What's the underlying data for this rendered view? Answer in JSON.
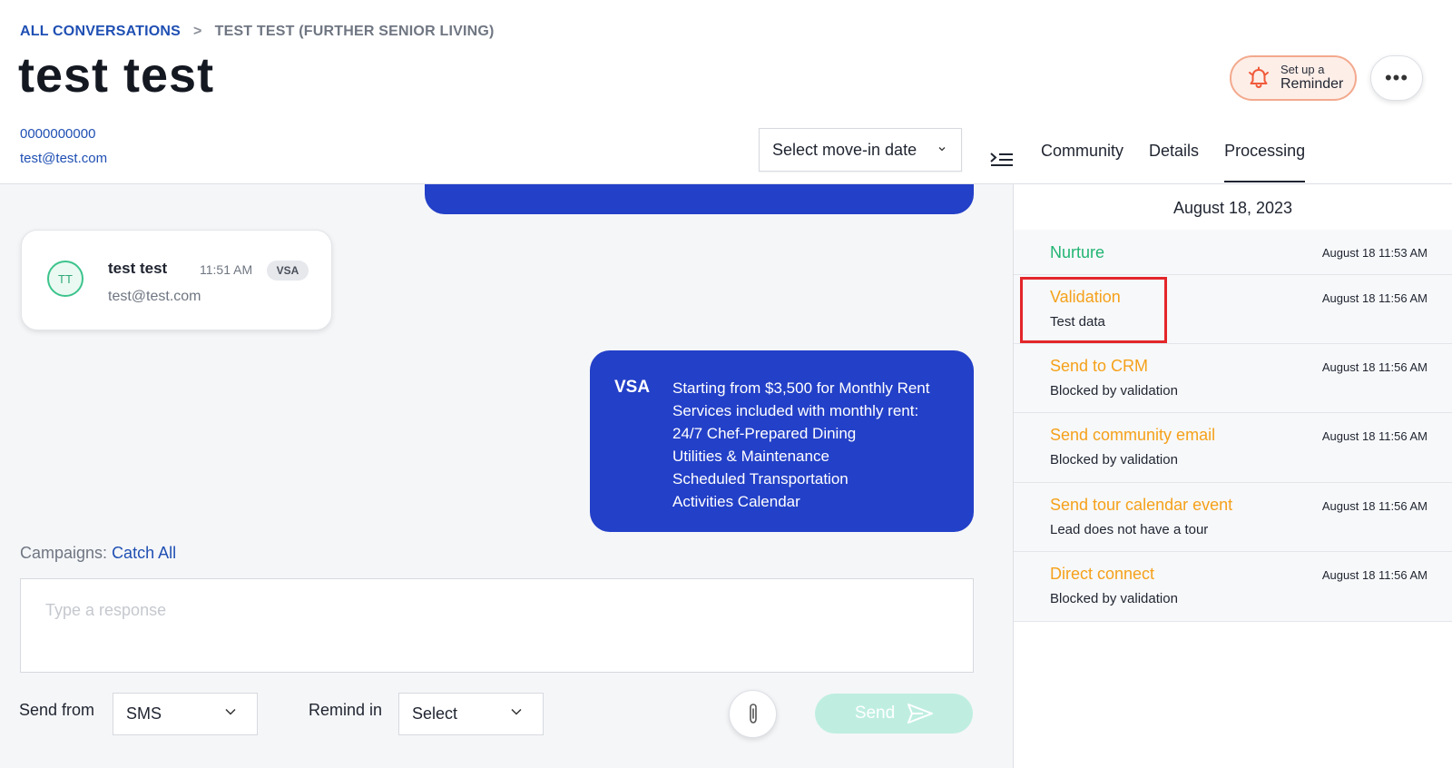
{
  "breadcrumb": {
    "root": "ALL CONVERSATIONS",
    "separator": ">",
    "current": "TEST TEST (FURTHER SENIOR LIVING)"
  },
  "page_title": "test test",
  "contact": {
    "phone": "0000000000",
    "email": "test@test.com"
  },
  "reminder_button": {
    "line1": "Set up a",
    "line2": "Reminder"
  },
  "more_button": "•••",
  "move_in_select": {
    "value": "Select move-in date"
  },
  "tabs": [
    "Community",
    "Details",
    "Processing"
  ],
  "active_tab": "Processing",
  "chat": {
    "card": {
      "initials": "TT",
      "name": "test test",
      "time": "11:51 AM",
      "badge": "VSA",
      "email": "test@test.com"
    },
    "message": {
      "sender": "VSA",
      "lines": [
        "Starting from $3,500 for Monthly Rent",
        "Services included with monthly rent:",
        "24/7 Chef-Prepared Dining",
        "Utilities & Maintenance",
        "Scheduled Transportation",
        "Activities Calendar"
      ]
    }
  },
  "campaigns": {
    "label": "Campaigns:",
    "value": "Catch All"
  },
  "composer": {
    "placeholder": "Type a response",
    "send_from_label": "Send from",
    "send_from_value": "SMS",
    "remind_in_label": "Remind in",
    "remind_in_value": "Select",
    "send_label": "Send"
  },
  "processing": {
    "date": "August 18, 2023",
    "steps": [
      {
        "name": "Nurture",
        "desc": "",
        "time": "August 18 11:53 AM",
        "status": "success",
        "color": "#22b573"
      },
      {
        "name": "Validation",
        "desc": "Test data",
        "time": "August 18 11:56 AM",
        "status": "warning",
        "color": "#f5a11a"
      },
      {
        "name": "Send to CRM",
        "desc": "Blocked by validation",
        "time": "August 18 11:56 AM",
        "status": "warning",
        "color": "#f5a11a"
      },
      {
        "name": "Send community email",
        "desc": "Blocked by validation",
        "time": "August 18 11:56 AM",
        "status": "warning",
        "color": "#f5a11a"
      },
      {
        "name": "Send tour calendar event",
        "desc": "Lead does not have a tour",
        "time": "August 18 11:56 AM",
        "status": "warning",
        "color": "#f5a11a"
      },
      {
        "name": "Direct connect",
        "desc": "Blocked by validation",
        "time": "August 18 11:56 AM",
        "status": "warning",
        "color": "#f5a11a"
      }
    ]
  },
  "colors": {
    "brand_blue": "#2340c8",
    "link_blue": "#1f4fb3",
    "success_green": "#22b573",
    "warning_orange": "#f5a11a",
    "send_button": "#bfeee1",
    "highlight_red": "#e3262a"
  },
  "icons": [
    "chevron-right-icon",
    "bell-icon",
    "more-icon",
    "chevron-down-icon",
    "collapse-panel-icon",
    "paperclip-icon",
    "send-icon"
  ]
}
